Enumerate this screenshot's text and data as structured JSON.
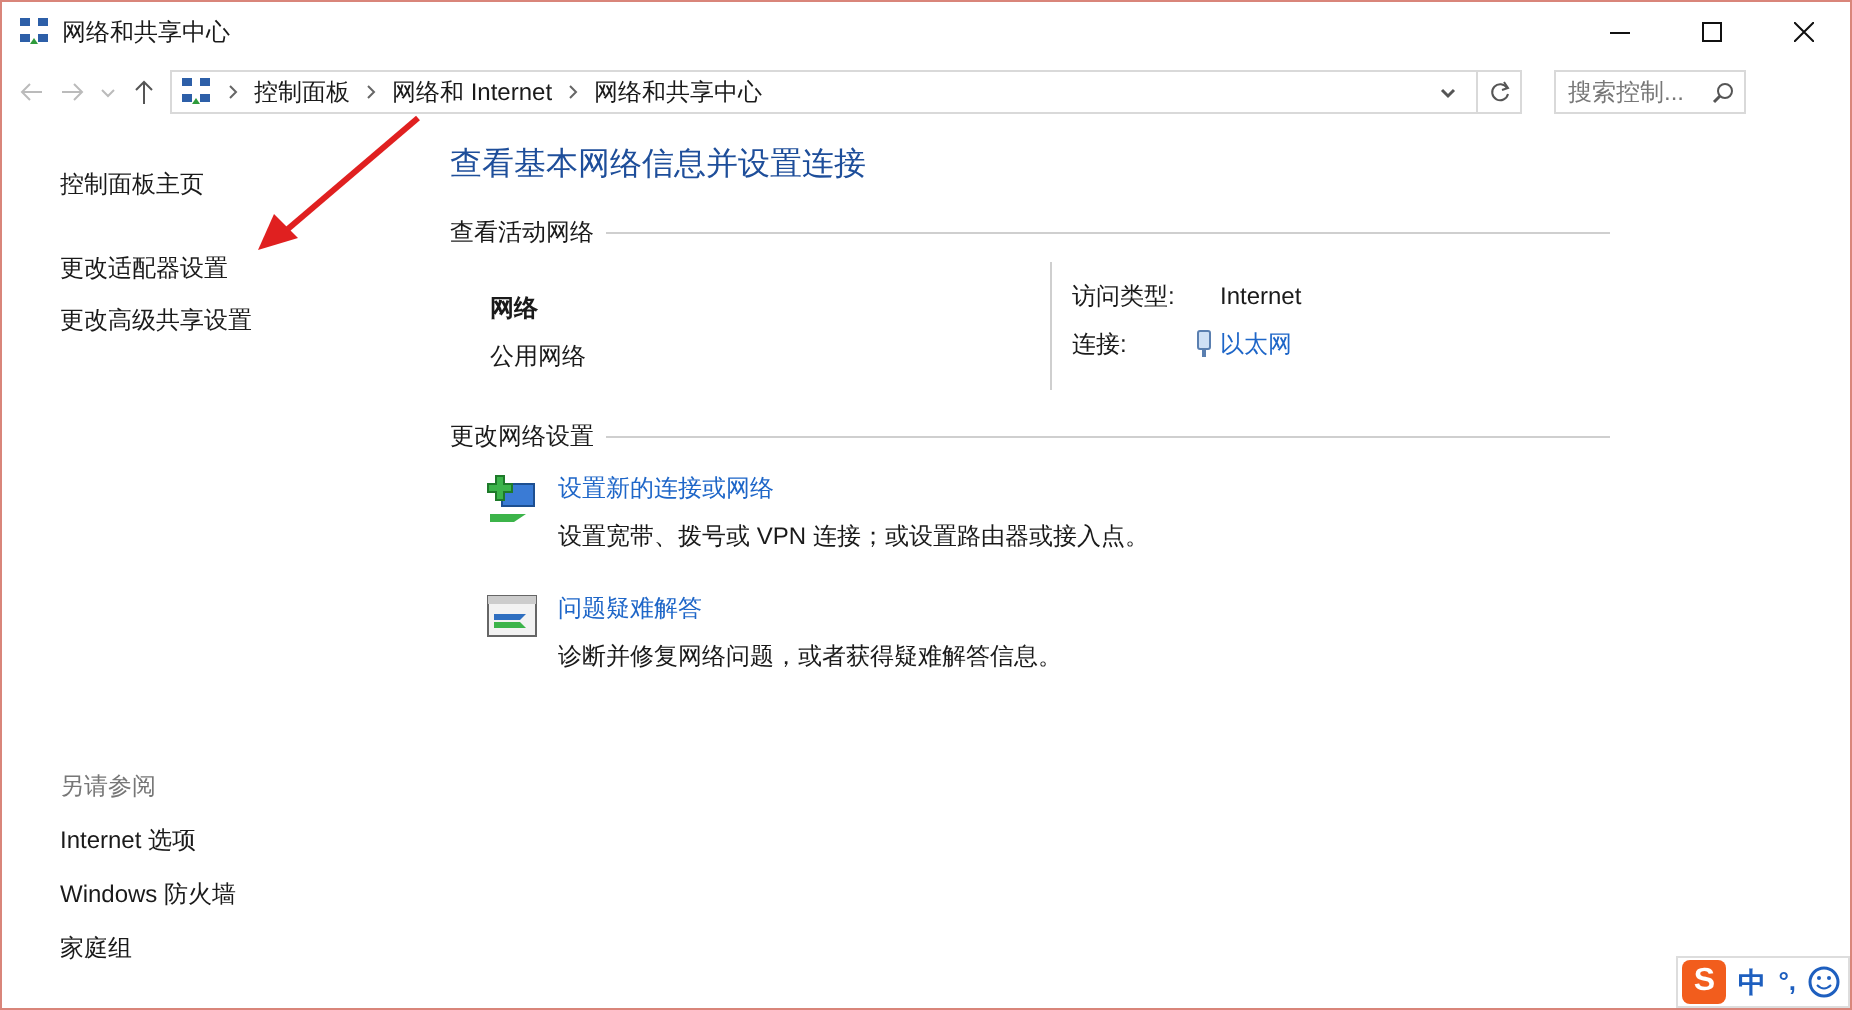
{
  "window": {
    "title": "网络和共享中心"
  },
  "address_bar": {
    "crumbs": [
      "控制面板",
      "网络和 Internet",
      "网络和共享中心"
    ]
  },
  "search": {
    "placeholder": "搜索控制..."
  },
  "sidebar": {
    "items": [
      "控制面板主页",
      "更改适配器设置",
      "更改高级共享设置"
    ],
    "see_also": {
      "title": "另请参阅",
      "items": [
        "Internet 选项",
        "Windows 防火墙",
        "家庭组"
      ]
    }
  },
  "main": {
    "heading": "查看基本网络信息并设置连接",
    "active_networks": {
      "title": "查看活动网络",
      "name": "网络",
      "category": "公用网络",
      "rows": [
        {
          "label": "访问类型:",
          "value": "Internet",
          "kind": "text"
        },
        {
          "label": "连接:",
          "value": "以太网",
          "kind": "link"
        }
      ]
    },
    "change_settings": {
      "title": "更改网络设置",
      "tasks": [
        {
          "kind": "new-connection",
          "link": "设置新的连接或网络",
          "description": "设置宽带、拨号或 VPN 连接；或设置路由器或接入点。"
        },
        {
          "kind": "troubleshoot",
          "link": "问题疑难解答",
          "description": "诊断并修复网络问题，或者获得疑难解答信息。"
        }
      ]
    }
  },
  "ime_bar": {
    "logo": "S",
    "mode": "中",
    "punctuation": "°,"
  }
}
